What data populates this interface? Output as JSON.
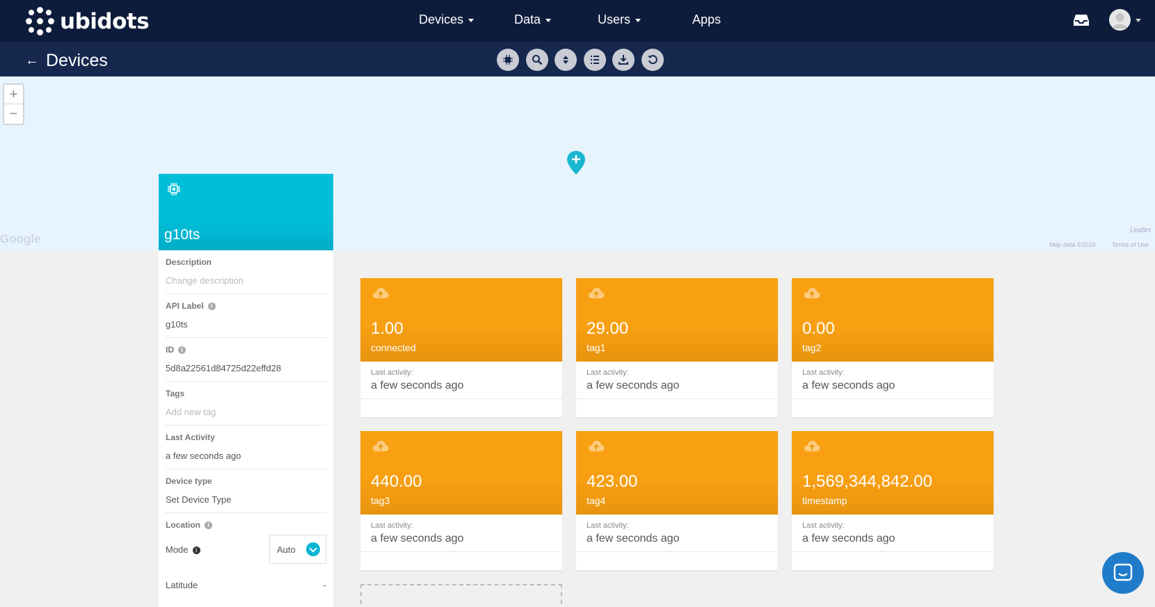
{
  "brand": {
    "name": "ubidots"
  },
  "nav": {
    "items": [
      {
        "label": "Devices",
        "dropdown": true
      },
      {
        "label": "Data",
        "dropdown": true
      },
      {
        "label": "Users",
        "dropdown": true
      },
      {
        "label": "Apps",
        "dropdown": false
      }
    ]
  },
  "subheader": {
    "title": "Devices",
    "tools": [
      "chip-icon",
      "search-icon",
      "sort-icon",
      "list-icon",
      "download-icon",
      "refresh-icon"
    ]
  },
  "map": {
    "zoom_in": "+",
    "zoom_out": "−",
    "google": "Google",
    "leaflet": "Leaflet",
    "map_data": "Map data ©2019",
    "terms": "Terms of Use"
  },
  "device": {
    "name": "g10ts",
    "fields": [
      {
        "label": "Description",
        "value": "Change description",
        "placeholder": true,
        "info": false
      },
      {
        "label": "API Label",
        "value": "g10ts",
        "placeholder": false,
        "info": true
      },
      {
        "label": "ID",
        "value": "5d8a22561d84725d22effd28",
        "placeholder": false,
        "info": true
      },
      {
        "label": "Tags",
        "value": "Add new tag",
        "placeholder": true,
        "info": false
      },
      {
        "label": "Last Activity",
        "value": "a few seconds ago",
        "placeholder": false,
        "info": false
      },
      {
        "label": "Device type",
        "value": "Set Device Type",
        "placeholder": false,
        "info": false
      }
    ],
    "location": {
      "label": "Location",
      "mode_label": "Mode",
      "mode_value": "Auto",
      "latitude_label": "Latitude",
      "latitude_value": "-"
    }
  },
  "variables": {
    "last_activity_label": "Last activity:",
    "items": [
      {
        "value": "1.00",
        "name": "connected",
        "last_activity": "a few seconds ago"
      },
      {
        "value": "29.00",
        "name": "tag1",
        "last_activity": "a few seconds ago"
      },
      {
        "value": "0.00",
        "name": "tag2",
        "last_activity": "a few seconds ago"
      },
      {
        "value": "440.00",
        "name": "tag3",
        "last_activity": "a few seconds ago"
      },
      {
        "value": "423.00",
        "name": "tag4",
        "last_activity": "a few seconds ago"
      },
      {
        "value": "1,569,344,842.00",
        "name": "timestamp",
        "last_activity": "a few seconds ago"
      }
    ]
  },
  "colors": {
    "nav_bg": "#0e1c3c",
    "subbar_bg": "#16284e",
    "device_accent": "#00bed8",
    "variable_accent": "#f9a012",
    "chat_bg": "#1f7ccb"
  }
}
